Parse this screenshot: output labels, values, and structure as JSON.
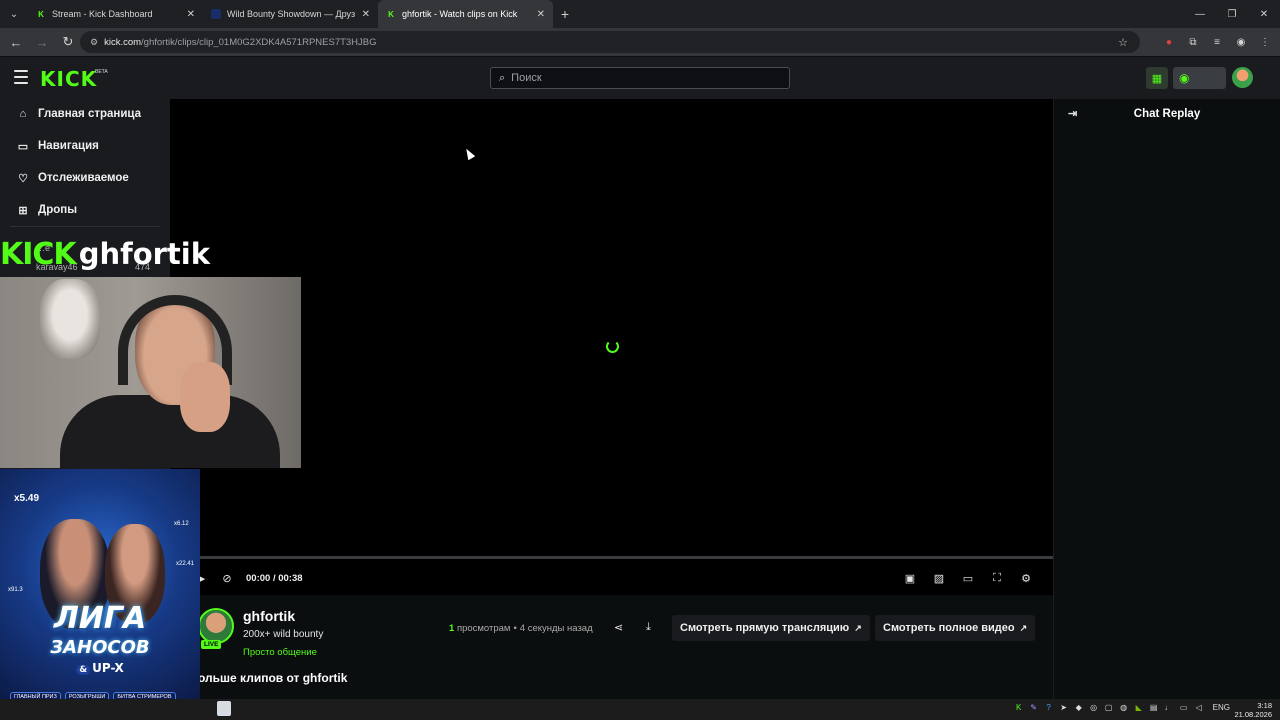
{
  "browser": {
    "tabs": [
      {
        "title": "Stream - Kick Dashboard",
        "active": false
      },
      {
        "title": "Wild Bounty Showdown — Друз",
        "active": false
      },
      {
        "title": "ghfortik - Watch clips on Kick",
        "active": true
      }
    ],
    "url_host": "kick.com",
    "url_path": "/ghfortik/clips/clip_01M0G2XDK4A571RPNES7T3HJBG"
  },
  "header": {
    "logo": "KICK",
    "logo_badge": "BETA",
    "search_placeholder": "Поиск"
  },
  "sidebar": {
    "items": [
      {
        "label": "Главная страница",
        "icon": "home-icon"
      },
      {
        "label": "Навигация",
        "icon": "compass-icon"
      },
      {
        "label": "Отслеживаемое",
        "icon": "heart-icon"
      },
      {
        "label": "Дропы",
        "icon": "gift-icon"
      }
    ],
    "partial_section": "…e",
    "partial_channel": "karavay46",
    "partial_count": "474"
  },
  "player": {
    "current_time": "00:00",
    "duration": "00:38",
    "time_separator": "/",
    "progress": 0
  },
  "chat": {
    "title": "Chat Replay"
  },
  "clip": {
    "channel": "ghfortik",
    "title": "200x+ wild bounty",
    "category": "Просто общение",
    "live_badge": "LIVE",
    "views_count": "1",
    "views_label": "просмотрам",
    "time_ago": "4 секунды назад",
    "watch_live_label": "Смотреть прямую трансляцию",
    "watch_full_label": "Смотреть полное видео",
    "more_clips": "ольше клипов от ghfortik"
  },
  "overlay": {
    "brand": "KICK",
    "name": "ghfortik",
    "promo_line1": "ЛИГА",
    "promo_line2": "ЗАНОСОВ",
    "promo_amp": "&",
    "promo_line3": "UP-X",
    "promo_mult1": "x5.49",
    "promo_mult2": "x6.12",
    "promo_mult3": "x22.41",
    "promo_mult4": "x91.3",
    "promo_pills": [
      "ГЛАВНЫЙ ПРИЗ",
      "РОЗЫГРЫШИ",
      "БИТВА СТРИМЕРОВ"
    ]
  },
  "taskbar": {
    "lang": "ENG",
    "time": "3:18",
    "date": "21.08.2026"
  }
}
